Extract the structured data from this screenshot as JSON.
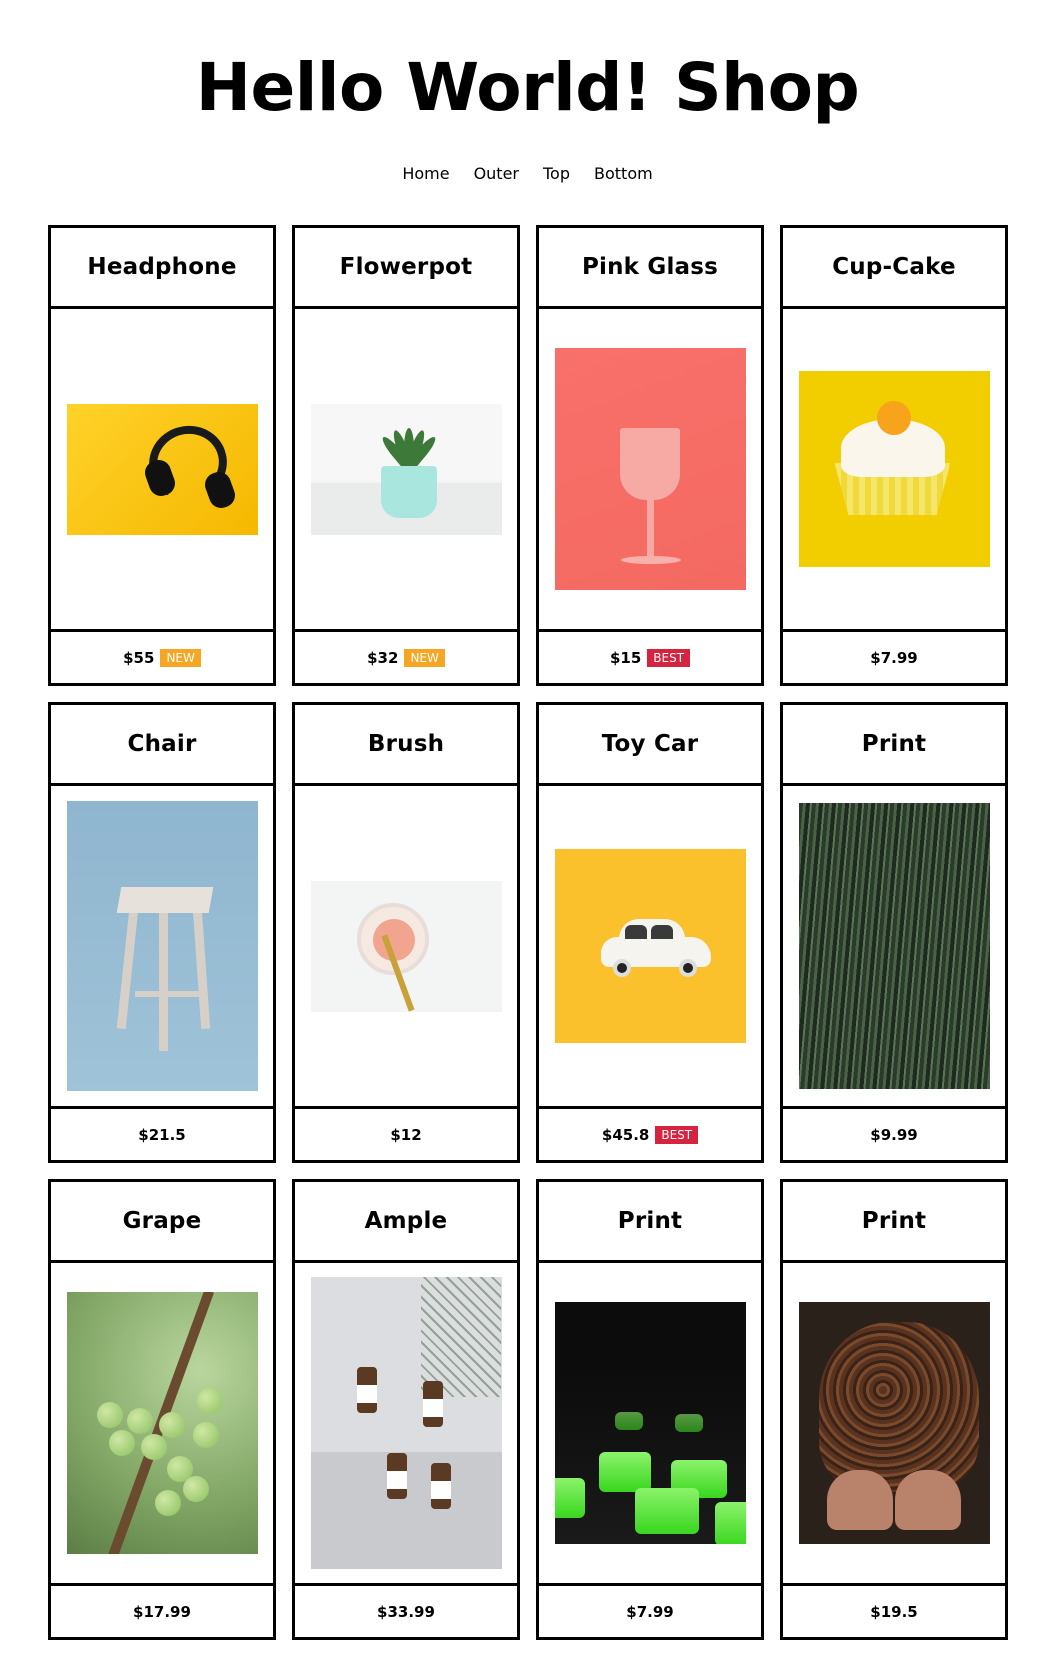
{
  "header": {
    "title": "Hello World! Shop"
  },
  "nav": {
    "items": [
      {
        "label": "Home"
      },
      {
        "label": "Outer"
      },
      {
        "label": "Top"
      },
      {
        "label": "Bottom"
      }
    ]
  },
  "products": [
    {
      "title": "Headphone",
      "price": "$55",
      "badge": "NEW",
      "badge_type": "new",
      "image": "headphone-image"
    },
    {
      "title": "Flowerpot",
      "price": "$32",
      "badge": "NEW",
      "badge_type": "new",
      "image": "flowerpot-image"
    },
    {
      "title": "Pink Glass",
      "price": "$15",
      "badge": "BEST",
      "badge_type": "best",
      "image": "pink-glass-image"
    },
    {
      "title": "Cup-Cake",
      "price": "$7.99",
      "badge": "",
      "badge_type": "none",
      "image": "cupcake-image"
    },
    {
      "title": "Chair",
      "price": "$21.5",
      "badge": "",
      "badge_type": "none",
      "image": "chair-image"
    },
    {
      "title": "Brush",
      "price": "$12",
      "badge": "",
      "badge_type": "none",
      "image": "brush-image"
    },
    {
      "title": "Toy Car",
      "price": "$45.8",
      "badge": "BEST",
      "badge_type": "best",
      "image": "toy-car-image"
    },
    {
      "title": "Print",
      "price": "$9.99",
      "badge": "",
      "badge_type": "none",
      "image": "field-print-image"
    },
    {
      "title": "Grape",
      "price": "$17.99",
      "badge": "",
      "badge_type": "none",
      "image": "grape-image"
    },
    {
      "title": "Ample",
      "price": "$33.99",
      "badge": "",
      "badge_type": "none",
      "image": "ample-bottles-image"
    },
    {
      "title": "Print",
      "price": "$7.99",
      "badge": "",
      "badge_type": "none",
      "image": "green-caps-print-image"
    },
    {
      "title": "Print",
      "price": "$19.5",
      "badge": "",
      "badge_type": "none",
      "image": "coffee-beans-print-image"
    }
  ],
  "colors": {
    "badge_new": "#f5a623",
    "badge_best": "#d6233f",
    "border": "#000000"
  }
}
